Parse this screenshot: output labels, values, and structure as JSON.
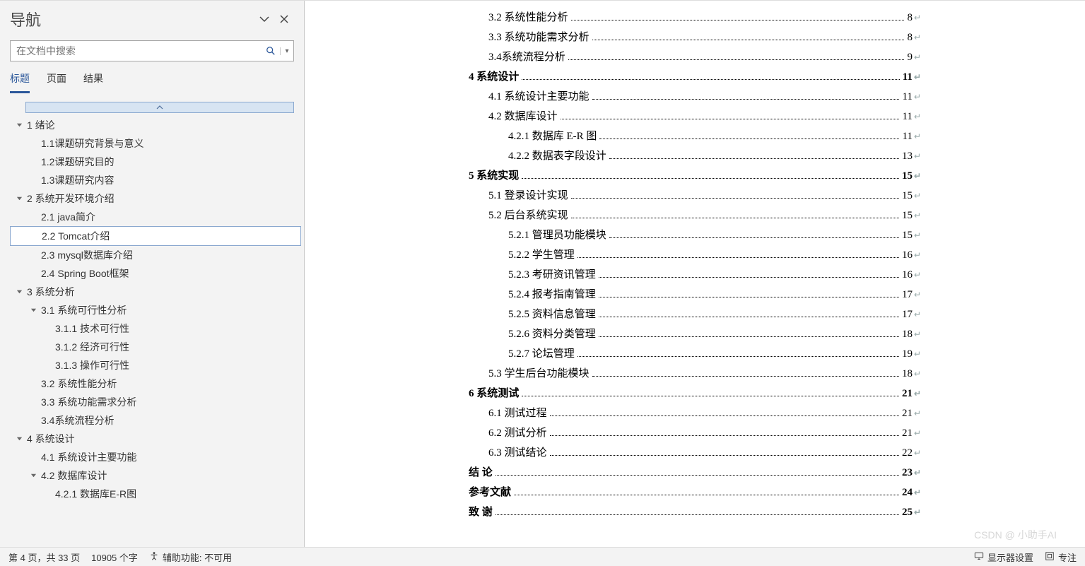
{
  "nav": {
    "title": "导航",
    "search_placeholder": "在文档中搜索",
    "tabs": {
      "headings": "标题",
      "pages": "页面",
      "results": "结果"
    },
    "tree": [
      {
        "level": 0,
        "caret": true,
        "label": "1 绪论"
      },
      {
        "level": 1,
        "caret": false,
        "label": "1.1课题研究背景与意义"
      },
      {
        "level": 1,
        "caret": false,
        "label": "1.2课题研究目的"
      },
      {
        "level": 1,
        "caret": false,
        "label": "1.3课题研究内容"
      },
      {
        "level": 0,
        "caret": true,
        "label": "2 系统开发环境介绍"
      },
      {
        "level": 1,
        "caret": false,
        "label": "2.1 java简介"
      },
      {
        "level": 1,
        "caret": false,
        "label": "2.2 Tomcat介绍",
        "selected": true
      },
      {
        "level": 1,
        "caret": false,
        "label": "2.3 mysql数据库介绍"
      },
      {
        "level": 1,
        "caret": false,
        "label": "2.4 Spring Boot框架"
      },
      {
        "level": 0,
        "caret": true,
        "label": "3 系统分析"
      },
      {
        "level": 1,
        "caret": true,
        "label": "3.1 系统可行性分析"
      },
      {
        "level": 2,
        "caret": false,
        "label": "3.1.1 技术可行性"
      },
      {
        "level": 2,
        "caret": false,
        "label": "3.1.2 经济可行性"
      },
      {
        "level": 2,
        "caret": false,
        "label": "3.1.3 操作可行性"
      },
      {
        "level": 1,
        "caret": false,
        "label": "3.2 系统性能分析"
      },
      {
        "level": 1,
        "caret": false,
        "label": "3.3 系统功能需求分析"
      },
      {
        "level": 1,
        "caret": false,
        "label": "3.4系统流程分析"
      },
      {
        "level": 0,
        "caret": true,
        "label": "4 系统设计"
      },
      {
        "level": 1,
        "caret": false,
        "label": "4.1 系统设计主要功能"
      },
      {
        "level": 1,
        "caret": true,
        "label": "4.2 数据库设计"
      },
      {
        "level": 2,
        "caret": false,
        "label": "4.2.1 数据库E-R图"
      }
    ]
  },
  "toc": [
    {
      "level": 1,
      "bold": false,
      "title": "3.2 系统性能分析",
      "page": "8"
    },
    {
      "level": 1,
      "bold": false,
      "title": "3.3 系统功能需求分析",
      "page": "8"
    },
    {
      "level": 1,
      "bold": false,
      "title": "3.4系统流程分析",
      "page": "9"
    },
    {
      "level": 0,
      "bold": true,
      "title": "4 系统设计",
      "page": "11"
    },
    {
      "level": 1,
      "bold": false,
      "title": "4.1 系统设计主要功能",
      "page": "11"
    },
    {
      "level": 1,
      "bold": false,
      "title": "4.2 数据库设计",
      "page": "11"
    },
    {
      "level": 2,
      "bold": false,
      "title": "4.2.1 数据库 E-R 图",
      "page": "11"
    },
    {
      "level": 2,
      "bold": false,
      "title": "4.2.2 数据表字段设计",
      "page": "13"
    },
    {
      "level": 0,
      "bold": true,
      "title": "5 系统实现",
      "page": "15"
    },
    {
      "level": 1,
      "bold": false,
      "title": "5.1 登录设计实现",
      "page": "15"
    },
    {
      "level": 1,
      "bold": false,
      "title": "5.2 后台系统实现",
      "page": "15"
    },
    {
      "level": 2,
      "bold": false,
      "title": "5.2.1 管理员功能模块",
      "page": "15"
    },
    {
      "level": 2,
      "bold": false,
      "title": "5.2.2 学生管理",
      "page": "16"
    },
    {
      "level": 2,
      "bold": false,
      "title": "5.2.3 考研资讯管理",
      "page": "16"
    },
    {
      "level": 2,
      "bold": false,
      "title": "5.2.4 报考指南管理",
      "page": "17"
    },
    {
      "level": 2,
      "bold": false,
      "title": "5.2.5 资料信息管理",
      "page": "17"
    },
    {
      "level": 2,
      "bold": false,
      "title": "5.2.6 资料分类管理",
      "page": "18"
    },
    {
      "level": 2,
      "bold": false,
      "title": "5.2.7 论坛管理",
      "page": "19"
    },
    {
      "level": 1,
      "bold": false,
      "title": "5.3 学生后台功能模块",
      "page": "18"
    },
    {
      "level": 0,
      "bold": true,
      "title": "6 系统测试",
      "page": "21"
    },
    {
      "level": 1,
      "bold": false,
      "title": "6.1 测试过程",
      "page": "21"
    },
    {
      "level": 1,
      "bold": false,
      "title": "6.2 测试分析",
      "page": "21"
    },
    {
      "level": 1,
      "bold": false,
      "title": "6.3 测试结论",
      "page": "22"
    },
    {
      "level": 0,
      "bold": true,
      "title": "结 论",
      "page": "23"
    },
    {
      "level": 0,
      "bold": true,
      "title": "参考文献",
      "page": "24"
    },
    {
      "level": 0,
      "bold": true,
      "title": "致 谢",
      "page": "25"
    }
  ],
  "status": {
    "page_label": "第 4 页，共 33 页",
    "word_count": "10905 个字",
    "accessibility": "辅助功能: 不可用",
    "display_settings": "显示器设置",
    "focus": "专注"
  },
  "watermark": "CSDN @ 小助手AI"
}
